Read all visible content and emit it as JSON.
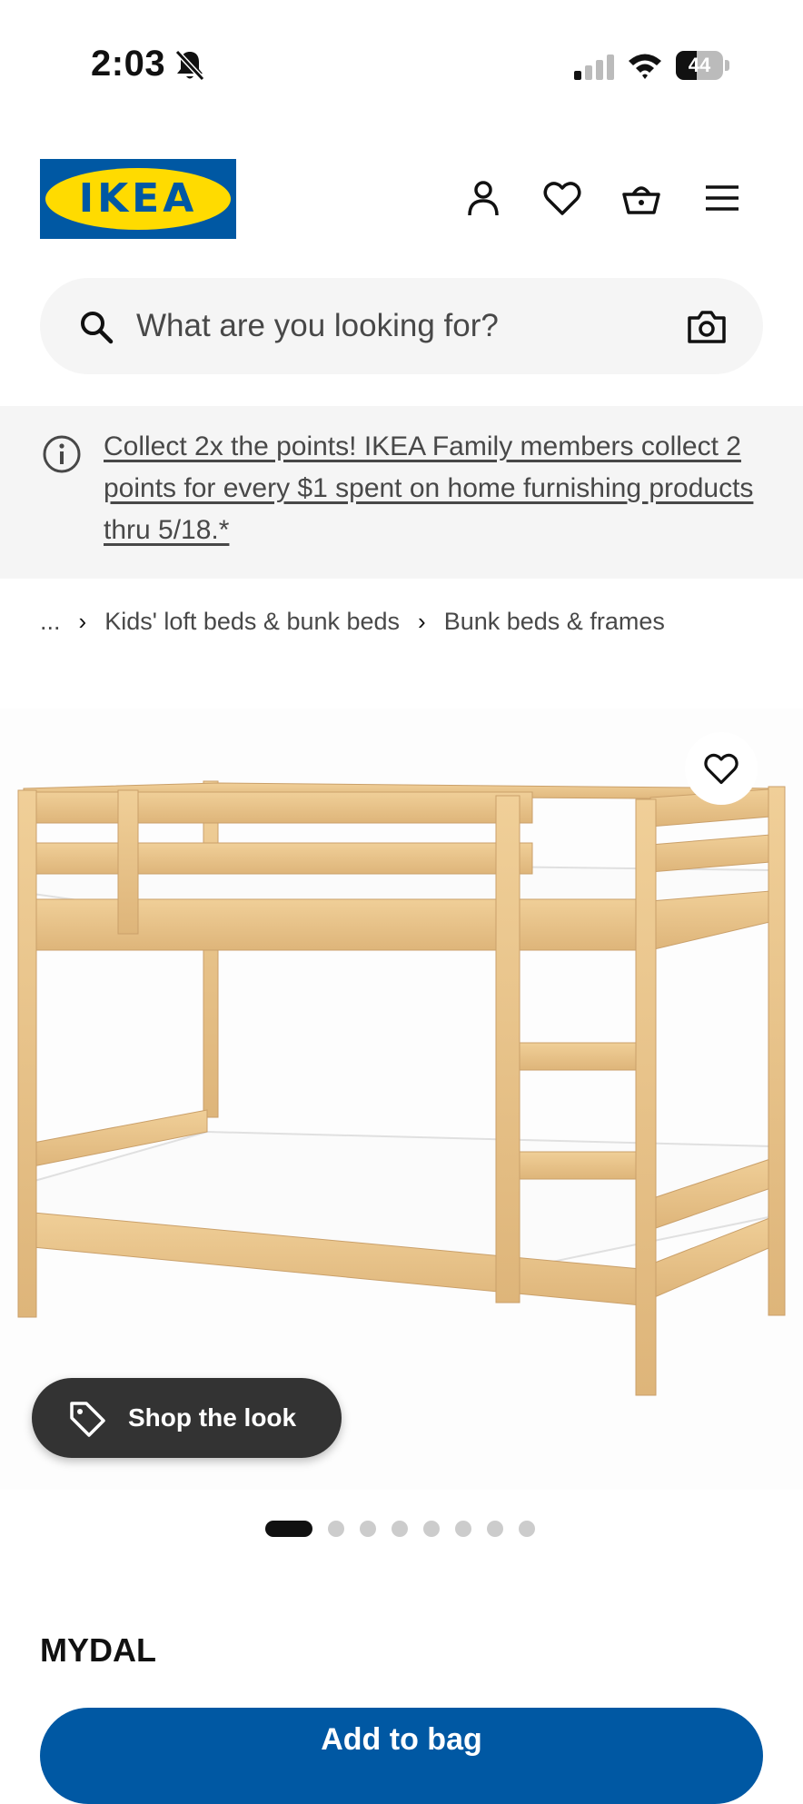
{
  "status_bar": {
    "time": "2:03",
    "battery": "44",
    "battery_level": 0.44
  },
  "header": {
    "logo_text": "IKEA",
    "icons": [
      "person-icon",
      "heart-icon",
      "basket-icon",
      "menu-icon"
    ]
  },
  "search": {
    "placeholder": "What are you looking for?"
  },
  "promo": {
    "text": "Collect 2x the points! IKEA Family members collect 2 points for every $1 spent on home furnishing products thru 5/18.*"
  },
  "breadcrumb": {
    "items": [
      "...",
      "Kids' loft beds & bunk beds",
      "Bunk beds & frames"
    ]
  },
  "gallery": {
    "shop_the_look": "Shop the look",
    "image_count": 8,
    "active_index": 0
  },
  "product": {
    "name": "MYDAL"
  },
  "cta": {
    "add_label": "Add to bag"
  },
  "colors": {
    "brand_blue": "#0058a3",
    "brand_yellow": "#ffdb00",
    "wood": "#e8c48a"
  }
}
